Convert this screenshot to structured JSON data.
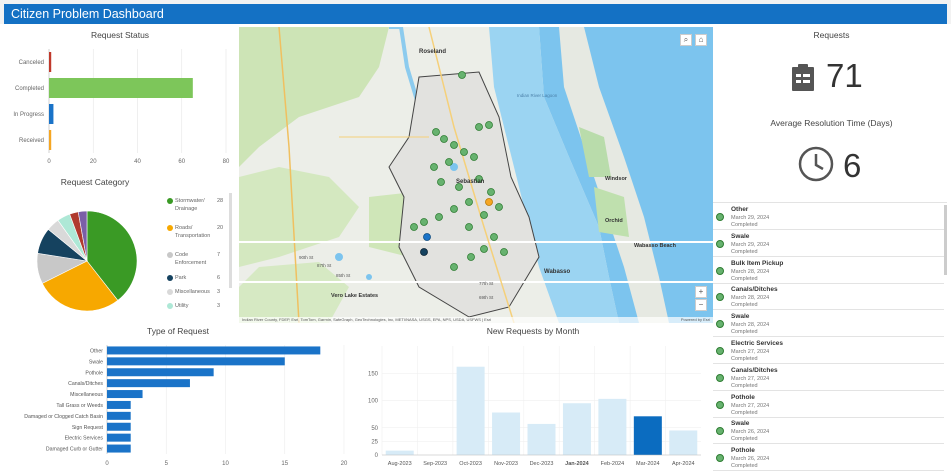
{
  "header": {
    "title": "Citizen Problem Dashboard"
  },
  "request_status": {
    "title": "Request Status",
    "chart_data": {
      "type": "bar",
      "orientation": "horizontal",
      "categories": [
        "Canceled",
        "Completed",
        "In Progress",
        "Received"
      ],
      "values": [
        1,
        65,
        2,
        1
      ],
      "colors": [
        "#c0392b",
        "#7dc65a",
        "#1a73c8",
        "#f5a623"
      ],
      "xlim": [
        0,
        80
      ],
      "xticks": [
        "0",
        "20",
        "40",
        "60",
        "80"
      ]
    }
  },
  "request_category": {
    "title": "Request Category",
    "chart_data": {
      "type": "pie",
      "slices": [
        {
          "label": "Stormwater/ Drainage",
          "value": 28,
          "color": "#3a9a25"
        },
        {
          "label": "Roads/ Transportation",
          "value": 20,
          "color": "#f7a800"
        },
        {
          "label": "Code Enforcement",
          "value": 7,
          "color": "#c8c8c8"
        },
        {
          "label": "Park",
          "value": 6,
          "color": "#15425f"
        },
        {
          "label": "Miscellaneous",
          "value": 3,
          "color": "#d9d9d9"
        },
        {
          "label": "Utility",
          "value": 3,
          "color": "#aee8d6"
        },
        {
          "label": "",
          "value": 2,
          "color": "#b03a2e"
        },
        {
          "label": "",
          "value": 2,
          "color": "#7b5ea7"
        }
      ],
      "legend": [
        {
          "label": "Stormwater/ Drainage",
          "value": "28",
          "color": "#3a9a25"
        },
        {
          "label": "Roads/ Transportation",
          "value": "20",
          "color": "#f7a800"
        },
        {
          "label": "Code Enforcement",
          "value": "7",
          "color": "#c8c8c8"
        },
        {
          "label": "Park",
          "value": "6",
          "color": "#15425f"
        },
        {
          "label": "Miscellaneous",
          "value": "3",
          "color": "#d9d9d9"
        },
        {
          "label": "Utility",
          "value": "3",
          "color": "#aee8d6"
        }
      ]
    }
  },
  "map": {
    "labels": {
      "roseland": "Roseland",
      "sebastian": "Sebastian",
      "wabasso": "Wabasso",
      "wabasso_beach": "Wabasso Beach",
      "vero_lake": "Vero Lake Estates",
      "orchid": "Orchid",
      "windsor": "Windsor",
      "indian_river": "Indian River Lagoon",
      "st_85": "85th St",
      "st_87": "87th St",
      "st_90": "90th St",
      "st_77": "77th St",
      "st_69": "69th St"
    },
    "attribution": "Indian River County, FDEP, Esri, TomTom, Garmin, SafeGraph, GeoTechnologies, Inc, METI/NASA, USGS, EPA, NPS, USDA, USFWS | Esri",
    "powered": "Powered by Esri",
    "zoom_in": "+",
    "zoom_out": "−"
  },
  "kpi": {
    "requests_label": "Requests",
    "requests_value": "71",
    "resolution_label": "Average Resolution Time (Days)",
    "resolution_value": "6"
  },
  "list": [
    {
      "title": "Other",
      "date": "March 29, 2024",
      "status": "Completed"
    },
    {
      "title": "Swale",
      "date": "March 29, 2024",
      "status": "Completed"
    },
    {
      "title": "Bulk Item Pickup",
      "date": "March 28, 2024",
      "status": "Completed"
    },
    {
      "title": "Canals/Ditches",
      "date": "March 28, 2024",
      "status": "Completed"
    },
    {
      "title": "Swale",
      "date": "March 28, 2024",
      "status": "Completed"
    },
    {
      "title": "Electric Services",
      "date": "March 27, 2024",
      "status": "Completed"
    },
    {
      "title": "Canals/Ditches",
      "date": "March 27, 2024",
      "status": "Completed"
    },
    {
      "title": "Pothole",
      "date": "March 27, 2024",
      "status": "Completed"
    },
    {
      "title": "Swale",
      "date": "March 26, 2024",
      "status": "Completed"
    },
    {
      "title": "Pothole",
      "date": "March 26, 2024",
      "status": "Completed"
    }
  ],
  "type_of_request": {
    "title": "Type of Request",
    "chart_data": {
      "type": "bar",
      "orientation": "horizontal",
      "categories": [
        "Other",
        "Swale",
        "Pothole",
        "Canals/Ditches",
        "Miscellaneous",
        "Tall Grass or Weeds",
        "Damaged or Clogged Catch Basin",
        "Sign Request",
        "Electric Services",
        "Damaged Curb or Gutter"
      ],
      "values": [
        18,
        15,
        9,
        7,
        3,
        2,
        2,
        2,
        2,
        2
      ],
      "color": "#1a73c8",
      "xlim": [
        0,
        20
      ],
      "xticks": [
        "0",
        "5",
        "10",
        "15",
        "20"
      ]
    }
  },
  "new_requests": {
    "title": "New Requests by Month",
    "chart_data": {
      "type": "bar",
      "categories": [
        "Aug-2023",
        "Sep-2023",
        "Oct-2023",
        "Nov-2023",
        "Dec-2023",
        "Jan-2024",
        "Feb-2024",
        "Mar-2024",
        "Apr-2024"
      ],
      "values": [
        8,
        0,
        162,
        78,
        57,
        95,
        103,
        71,
        45
      ],
      "highlight_index": 7,
      "bold_categories": [
        "Jan-2024"
      ],
      "ylim": [
        0,
        200
      ],
      "yticks": [
        "0",
        "25",
        "50",
        "100",
        "150"
      ],
      "color": "#d7ebf7",
      "highlight_color": "#0b6cc0"
    }
  }
}
